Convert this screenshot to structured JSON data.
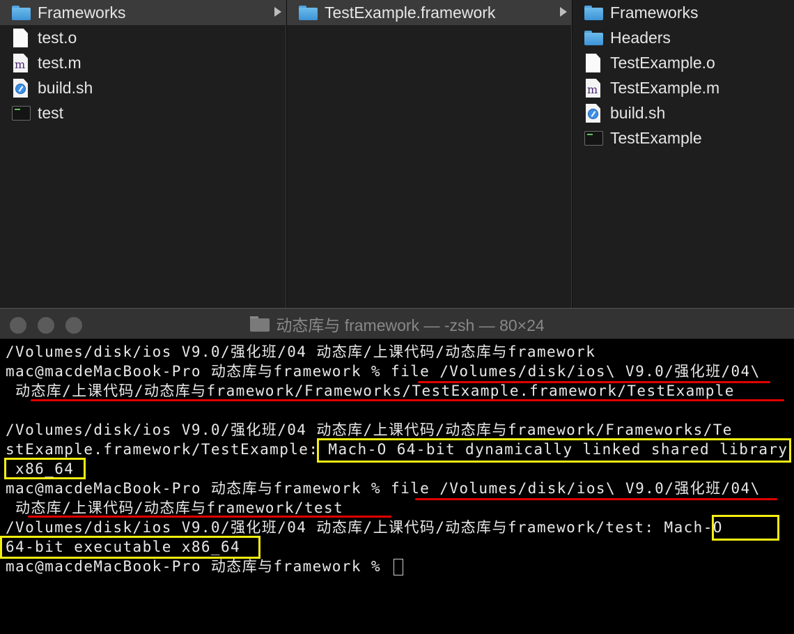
{
  "finder": {
    "column1": [
      {
        "label": "Frameworks",
        "icon": "folder-icon",
        "selected": true
      },
      {
        "label": "test.o",
        "icon": "document-icon"
      },
      {
        "label": "test.m",
        "icon": "objc-source-icon"
      },
      {
        "label": "build.sh",
        "icon": "shell-script-icon"
      },
      {
        "label": "test",
        "icon": "terminal-executable-icon"
      }
    ],
    "column2": [
      {
        "label": "TestExample.framework",
        "icon": "folder-icon",
        "selected": true
      }
    ],
    "column3": [
      {
        "label": "Frameworks",
        "icon": "folder-icon"
      },
      {
        "label": "Headers",
        "icon": "folder-icon"
      },
      {
        "label": "TestExample.o",
        "icon": "document-icon"
      },
      {
        "label": "TestExample.m",
        "icon": "objc-source-icon"
      },
      {
        "label": "build.sh",
        "icon": "shell-script-icon"
      },
      {
        "label": "TestExample",
        "icon": "terminal-executable-icon"
      }
    ]
  },
  "terminal": {
    "title": "动态库与 framework — -zsh — 80×24",
    "lines": [
      "/Volumes/disk/ios V9.0/强化班/04 动态库/上课代码/动态库与framework",
      "mac@macdeMacBook-Pro 动态库与framework % file /Volumes/disk/ios\\ V9.0/强化班/04\\",
      " 动态库/上课代码/动态库与framework/Frameworks/TestExample.framework/TestExample",
      "",
      "/Volumes/disk/ios V9.0/强化班/04 动态库/上课代码/动态库与framework/Frameworks/Te",
      "stExample.framework/TestExample: Mach-O 64-bit dynamically linked shared library",
      " x86_64",
      "mac@macdeMacBook-Pro 动态库与framework % file /Volumes/disk/ios\\ V9.0/强化班/04\\",
      " 动态库/上课代码/动态库与framework/test",
      "/Volumes/disk/ios V9.0/强化班/04 动态库/上课代码/动态库与framework/test: Mach-O",
      "64-bit executable x86_64",
      "mac@macdeMacBook-Pro 动态库与framework % "
    ],
    "annotation_colors": {
      "underline": "#e10000",
      "highlight_box": "#f5ee13"
    }
  }
}
